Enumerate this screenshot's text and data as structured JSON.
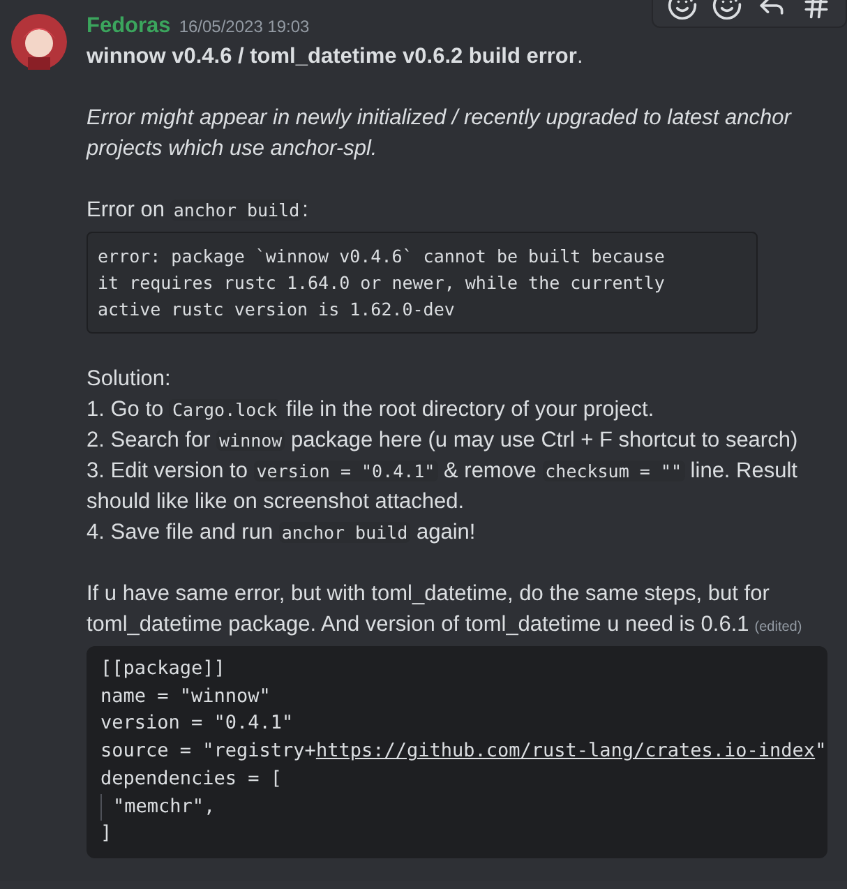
{
  "author": {
    "name": "Fedoras",
    "timestamp": "16/05/2023 19:03"
  },
  "blocks": [
    {
      "kind": "title",
      "text": "**winnow v0.4.6 / toml_datetime v0.6.2 build error**."
    },
    {
      "kind": "note",
      "text": "Error might appear in newly initialized / recently upgraded to latest anchor projects which use anchor-spl."
    },
    {
      "kind": "paragraph",
      "lines": [
        [
          {
            "text": "Error on "
          },
          {
            "text": "anchor build",
            "code": true
          },
          {
            "text": ":"
          }
        ]
      ]
    },
    {
      "kind": "codeblock",
      "lines": [
        "error: package `winnow v0.4.6` cannot be built because",
        "it requires rustc 1.64.0 or newer, while the currently",
        "active rustc version is 1.62.0-dev"
      ]
    },
    {
      "kind": "paragraph",
      "lines": [
        [
          {
            "text": "Solution:"
          }
        ],
        [
          {
            "text": "1. Go to "
          },
          {
            "text": "Cargo.lock",
            "code": true
          },
          {
            "text": " file in the root directory of your project."
          }
        ],
        [
          {
            "text": "2. Search for "
          },
          {
            "text": "winnow",
            "code": true
          },
          {
            "text": " package here (u may use Ctrl + F shortcut to search)"
          }
        ],
        [
          {
            "text": "3. Edit version to "
          },
          {
            "text": "version = \"0.4.1\"",
            "code": true
          },
          {
            "text": " & remove "
          },
          {
            "text": "checksum = \"\"",
            "code": true
          },
          {
            "text": " line. Result should like like on screenshot attached."
          }
        ],
        [
          {
            "text": "4. Save file and run "
          },
          {
            "text": "anchor build",
            "code": true
          },
          {
            "text": " again!"
          }
        ]
      ]
    },
    {
      "kind": "paragraph",
      "lines": [
        [
          {
            "text": "If u have same error, but with toml_datetime, do the same steps, but for toml_datetime package. And version of toml_datetime u need is 0.6.1"
          }
        ]
      ],
      "edited": "(edited)"
    },
    {
      "kind": "snippet",
      "lines": [
        {
          "segments": [
            {
              "text": "[[package]]"
            }
          ],
          "indented": false
        },
        {
          "segments": [
            {
              "text": "name = \"winnow\""
            }
          ],
          "indented": false
        },
        {
          "segments": [
            {
              "text": "version = \"0.4.1\""
            }
          ],
          "indented": false
        },
        {
          "segments": [
            {
              "text": "source = \"registry+"
            },
            {
              "text": "https://github.com/rust-lang/crates.io-index",
              "link": true
            },
            {
              "text": "\""
            }
          ],
          "indented": false
        },
        {
          "segments": [
            {
              "text": "dependencies = ["
            }
          ],
          "indented": false
        },
        {
          "segments": [
            {
              "text": "\"memchr\","
            }
          ],
          "indented": true
        },
        {
          "segments": [
            {
              "text": "]"
            }
          ],
          "indented": false
        }
      ]
    }
  ]
}
